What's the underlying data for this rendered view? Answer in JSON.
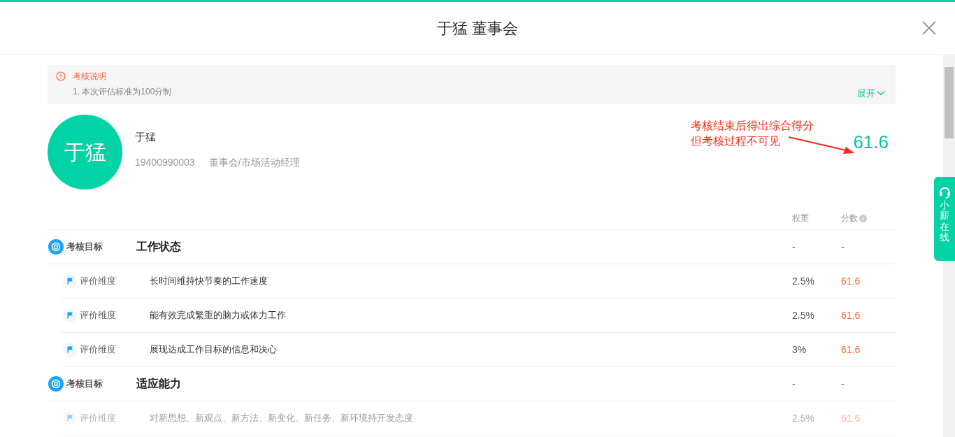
{
  "header": {
    "title": "于猛 董事会"
  },
  "notice": {
    "title": "考核说明",
    "lines": [
      "1. 本次评估标准为100分制"
    ],
    "toggle": "展开"
  },
  "profile": {
    "avatar_text": "于猛",
    "name": "于猛",
    "phone": "19400990003",
    "dept": "董事会/市场活动经理",
    "score": "61.6"
  },
  "annotation": {
    "lines": [
      "考核结束后得出综合得分",
      "但考核过程不可见"
    ]
  },
  "table": {
    "columns": [
      "权重",
      "分数"
    ],
    "rows": [
      {
        "kind": "goal",
        "tag": "考核目标",
        "title": "工作状态",
        "weight": "-",
        "score": "-",
        "faded": false
      },
      {
        "kind": "dimension",
        "tag": "评价维度",
        "title": "长时间维持快节奏的工作速度",
        "weight": "2.5%",
        "score": "61.6",
        "faded": false
      },
      {
        "kind": "dimension",
        "tag": "评价维度",
        "title": "能有效完成繁重的脑力或体力工作",
        "weight": "2.5%",
        "score": "61.6",
        "faded": false
      },
      {
        "kind": "dimension",
        "tag": "评价维度",
        "title": "展现达成工作目标的信息和决心",
        "weight": "3%",
        "score": "61.6",
        "faded": false
      },
      {
        "kind": "goal",
        "tag": "考核目标",
        "title": "适应能力",
        "weight": "-",
        "score": "-",
        "faded": false
      },
      {
        "kind": "dimension",
        "tag": "评价维度",
        "title": "对新思想、新观点、新方法、新变化、新任务、新环境持开发态度",
        "weight": "2.5%",
        "score": "61.6",
        "faded": true
      }
    ]
  },
  "chat_widget": {
    "label": "小薪在线"
  }
}
